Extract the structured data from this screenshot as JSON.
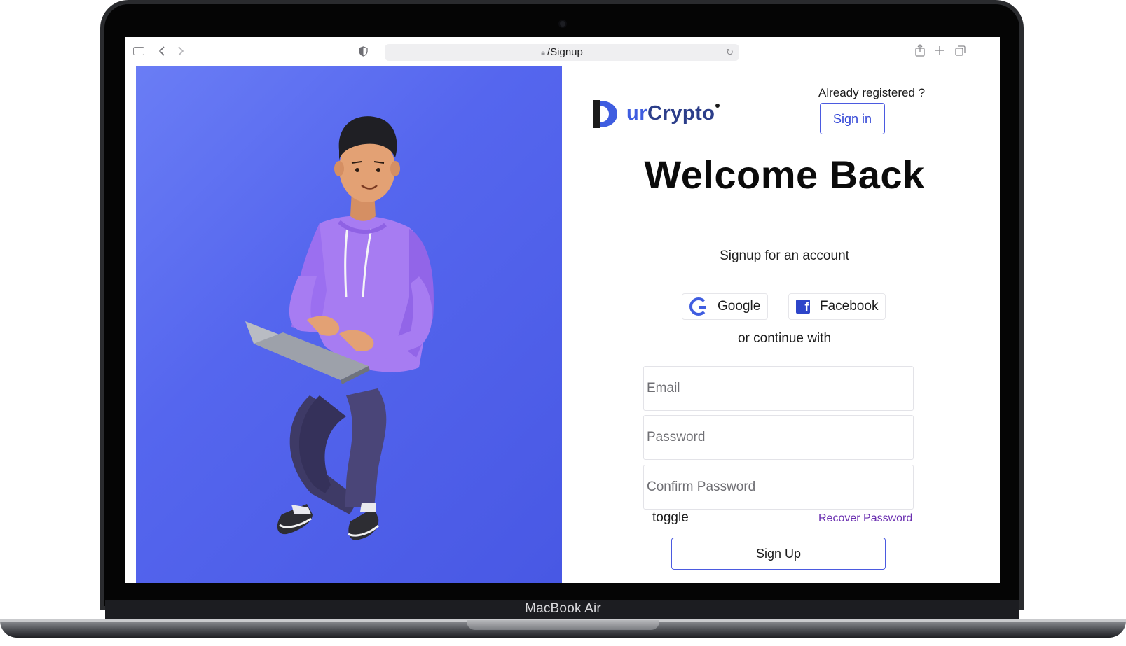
{
  "device": {
    "model_label": "MacBook Air"
  },
  "browser": {
    "url": "/Signup",
    "icons": [
      "sidebar-icon",
      "back-icon",
      "forward-icon",
      "shield-icon",
      "lock-icon",
      "reload-icon",
      "share-icon",
      "new-tab-icon",
      "tabs-icon"
    ]
  },
  "brand": {
    "name_prefix": "ur",
    "name_suffix": "Crypto"
  },
  "header": {
    "already_registered": "Already registered ?",
    "signin_label": "Sign in"
  },
  "main": {
    "title": "Welcome Back",
    "subtitle": "Signup for an account",
    "social": {
      "google_label": "Google",
      "facebook_label": "Facebook"
    },
    "divider_text": "or continue with",
    "form": {
      "email_placeholder": "Email",
      "password_placeholder": "Password",
      "confirm_placeholder": "Confirm Password",
      "toggle_label": "toggle",
      "recover_label": "Recover Password",
      "submit_label": "Sign Up"
    }
  },
  "colors": {
    "accent": "#4b5ae0",
    "hero_background": "#5566ee",
    "hoodie": "#a77cf2",
    "pants": "#3e3a66",
    "link": "#6a2fb0"
  }
}
